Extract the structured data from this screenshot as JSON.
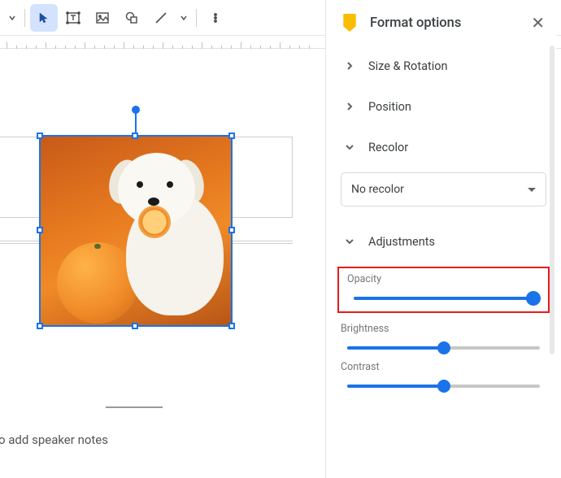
{
  "panel": {
    "title": "Format options",
    "sections": {
      "size_rotation": "Size & Rotation",
      "position": "Position",
      "recolor": "Recolor",
      "adjustments": "Adjustments"
    },
    "recolor_value": "No recolor",
    "adjustments": {
      "opacity": {
        "label": "Opacity",
        "value": 100,
        "min": 0,
        "max": 100
      },
      "brightness": {
        "label": "Brightness",
        "value": 50,
        "min": 0,
        "max": 100
      },
      "contrast": {
        "label": "Contrast",
        "value": 50,
        "min": 0,
        "max": 100
      }
    }
  },
  "speaker_notes_placeholder": "o add speaker notes",
  "colors": {
    "accent": "#1a73e8",
    "highlight_box": "#e81a1a",
    "brand_icon": "#fbbc04"
  },
  "toolbar_icons": [
    "more-dropdown",
    "select",
    "textbox",
    "image",
    "shape",
    "line",
    "line-dropdown",
    "overflow"
  ],
  "selection": {
    "type": "image",
    "description": "white fluffy dog with orange fruit on orange background"
  }
}
